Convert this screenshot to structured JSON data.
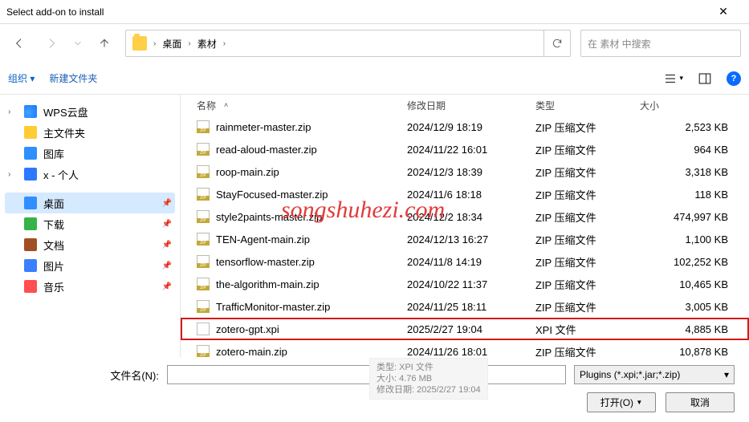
{
  "window": {
    "title": "Select add-on to install"
  },
  "breadcrumb": {
    "parts": [
      "桌面",
      "素材"
    ]
  },
  "search": {
    "placeholder": "在 素材 中搜索"
  },
  "toolbar": {
    "organize": "组织",
    "newfolder": "新建文件夹"
  },
  "sidebar": {
    "quick": [
      {
        "label": "WPS云盘",
        "icon": "cloud-b",
        "expandable": true
      },
      {
        "label": "主文件夹",
        "icon": "home",
        "expandable": false
      },
      {
        "label": "图库",
        "icon": "lib",
        "expandable": false
      },
      {
        "label": "x - 个人",
        "icon": "cloud-c",
        "expandable": true
      }
    ],
    "locations": [
      {
        "label": "桌面",
        "icon": "desk",
        "selected": true
      },
      {
        "label": "下载",
        "icon": "dl"
      },
      {
        "label": "文档",
        "icon": "doc"
      },
      {
        "label": "图片",
        "icon": "pic"
      },
      {
        "label": "音乐",
        "icon": "mus"
      }
    ]
  },
  "columns": {
    "name": "名称",
    "date": "修改日期",
    "type": "类型",
    "size": "大小"
  },
  "files": [
    {
      "name": "rainmeter-master.zip",
      "date": "2024/12/9 18:19",
      "type": "ZIP 压缩文件",
      "size": "2,523 KB",
      "icon": "zip"
    },
    {
      "name": "read-aloud-master.zip",
      "date": "2024/11/22 16:01",
      "type": "ZIP 压缩文件",
      "size": "964 KB",
      "icon": "zip"
    },
    {
      "name": "roop-main.zip",
      "date": "2024/12/3 18:39",
      "type": "ZIP 压缩文件",
      "size": "3,318 KB",
      "icon": "zip"
    },
    {
      "name": "StayFocused-master.zip",
      "date": "2024/11/6 18:18",
      "type": "ZIP 压缩文件",
      "size": "118 KB",
      "icon": "zip"
    },
    {
      "name": "style2paints-master.zip",
      "date": "2024/12/2 18:34",
      "type": "ZIP 压缩文件",
      "size": "474,997 KB",
      "icon": "zip"
    },
    {
      "name": "TEN-Agent-main.zip",
      "date": "2024/12/13 16:27",
      "type": "ZIP 压缩文件",
      "size": "1,100 KB",
      "icon": "zip"
    },
    {
      "name": "tensorflow-master.zip",
      "date": "2024/11/8 14:19",
      "type": "ZIP 压缩文件",
      "size": "102,252 KB",
      "icon": "zip"
    },
    {
      "name": "the-algorithm-main.zip",
      "date": "2024/10/22 11:37",
      "type": "ZIP 压缩文件",
      "size": "10,465 KB",
      "icon": "zip"
    },
    {
      "name": "TrafficMonitor-master.zip",
      "date": "2024/11/25 18:11",
      "type": "ZIP 压缩文件",
      "size": "3,005 KB",
      "icon": "zip"
    },
    {
      "name": "zotero-gpt.xpi",
      "date": "2025/2/27 19:04",
      "type": "XPI 文件",
      "size": "4,885 KB",
      "icon": "file",
      "highlight": true
    },
    {
      "name": "zotero-main.zip",
      "date": "2024/11/26 18:01",
      "type": "ZIP 压缩文件",
      "size": "10,878 KB",
      "icon": "zip"
    }
  ],
  "tooltip": {
    "line1": "类型: XPI 文件",
    "line2": "大小: 4.76 MB",
    "line3": "修改日期: 2025/2/27 19:04"
  },
  "watermark": "songshuhezi.com",
  "footer": {
    "filename_label": "文件名(N):",
    "filter": "Plugins (*.xpi;*.jar;*.zip)",
    "open": "打开(O)",
    "cancel": "取消"
  }
}
